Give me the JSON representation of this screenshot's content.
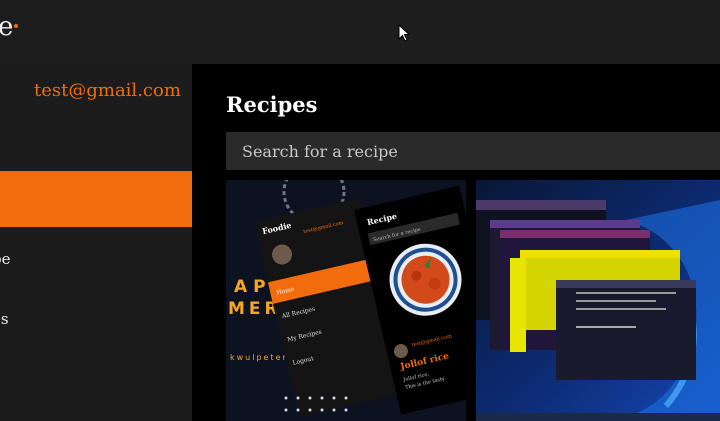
{
  "app": {
    "logo_fragment": "e",
    "accent_color": "#f26c0d"
  },
  "user": {
    "email": "test@gmail.com"
  },
  "sidebar": {
    "items": [
      {
        "label": "pe",
        "active": false
      },
      {
        "label": "es",
        "active": false
      }
    ]
  },
  "main": {
    "title": "Recipes",
    "search_placeholder": "Search for a recipe"
  },
  "recipes": [
    {
      "thumbnail": "foodie-app-screenshot",
      "text": {
        "brand": "Foodie",
        "email": "test@gmail.com",
        "panel_title": "Recipe",
        "search": "Search for a recipe",
        "menu": [
          "Home",
          "All Recipes",
          "My Recipes",
          "Logout"
        ],
        "big_a": "APP",
        "big_b": "MERN",
        "handle": "kwulpeter",
        "item_title": "Jollof rice",
        "author": "test@gmail.com",
        "desc_a": "Jollof rice, ",
        "desc_b": "This is the tasty"
      }
    },
    {
      "thumbnail": "desktop-windows-screenshot"
    }
  ]
}
